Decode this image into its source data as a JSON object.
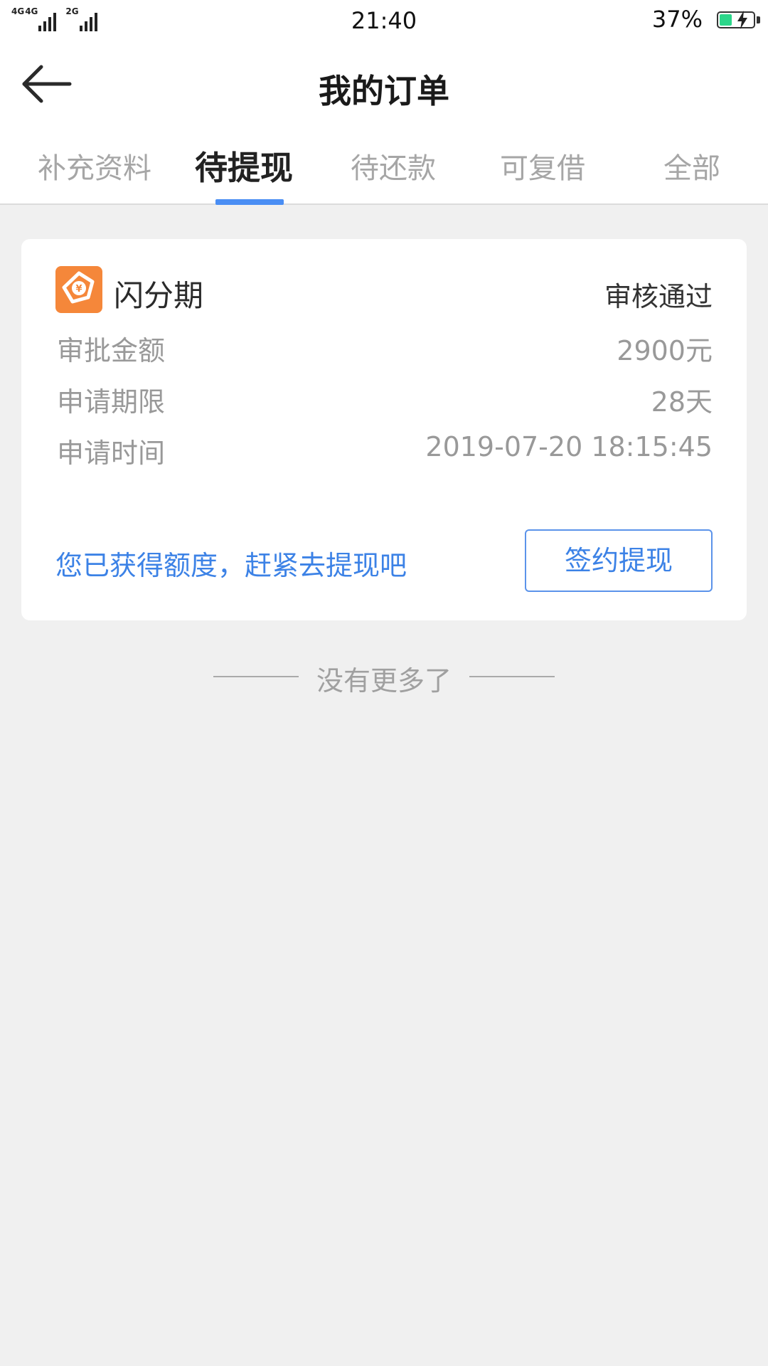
{
  "status_bar": {
    "network_1": "4G",
    "network_2": "4G",
    "network_3": "2G",
    "time": "21:40",
    "battery_percent": "37%",
    "battery_level": 0.37,
    "charging": true
  },
  "header": {
    "back_icon": "arrow-left-icon",
    "title": "我的订单"
  },
  "tabs": [
    {
      "label": "补充资料",
      "active": false
    },
    {
      "label": "待提现",
      "active": true
    },
    {
      "label": "待还款",
      "active": false
    },
    {
      "label": "可复借",
      "active": false
    },
    {
      "label": "全部",
      "active": false
    }
  ],
  "order": {
    "brand_logo_icon": "flash-installment-logo",
    "brand_name": "闪分期",
    "status": "审核通过",
    "rows": [
      {
        "label": "审批金额",
        "value": "2900元"
      },
      {
        "label": "申请期限",
        "value": "28天"
      },
      {
        "label": "申请时间",
        "value": "2019-07-20 18:15:45"
      }
    ],
    "hint": "您已获得额度，赶紧去提现吧",
    "action_label": "签约提现"
  },
  "footer": {
    "no_more_text": "没有更多了"
  },
  "colors": {
    "accent": "#4a8ef4",
    "link": "#3c82e6",
    "brand_orange": "#f5873a",
    "battery": "#2bd68a",
    "background": "#f0f0f0"
  }
}
